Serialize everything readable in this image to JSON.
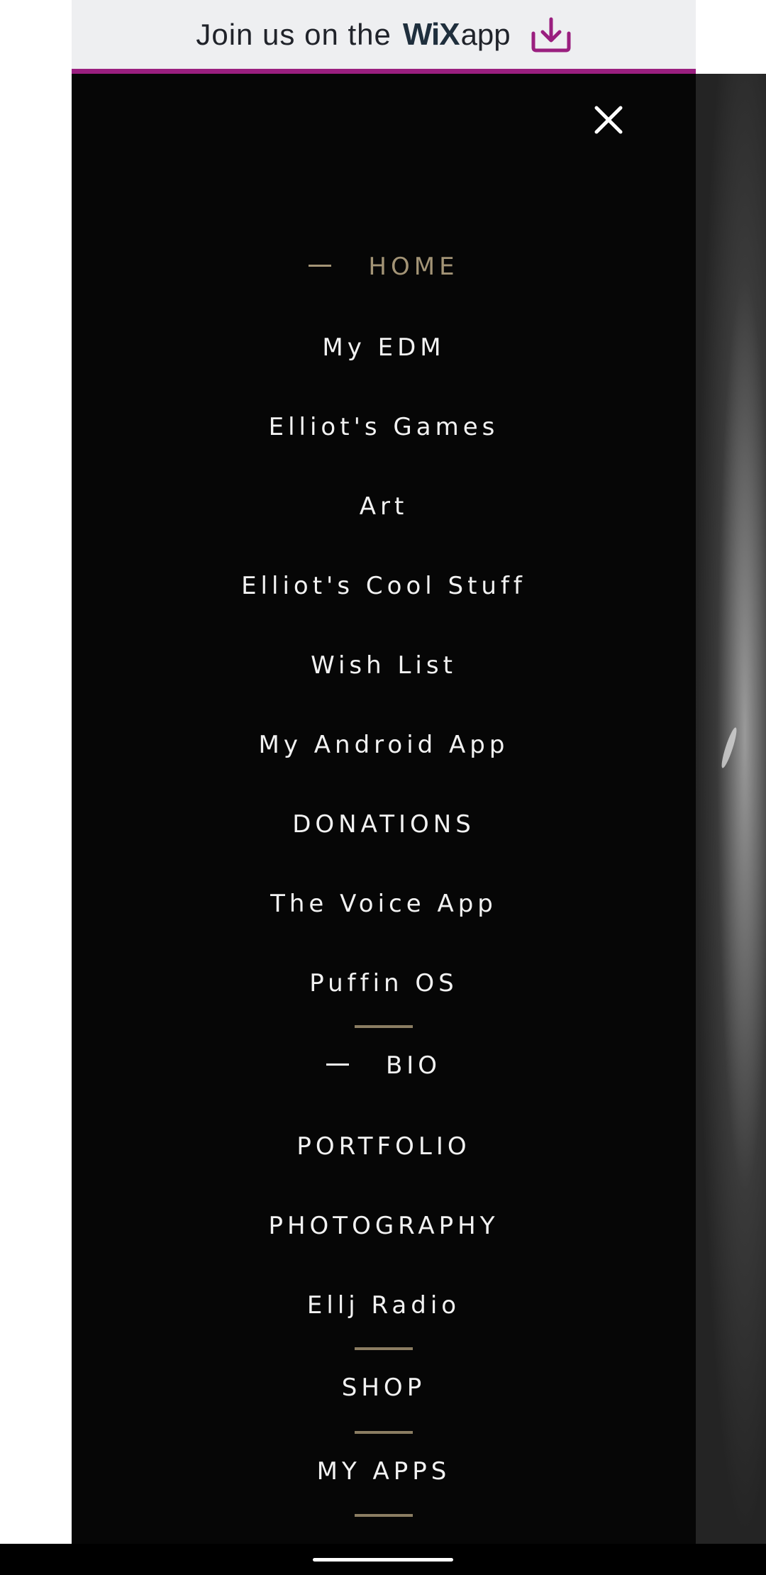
{
  "banner": {
    "text": "Join us on the",
    "logo_text": "WiX",
    "app_word": "app",
    "icon": "download-icon",
    "accent_color": "#9a1f7f",
    "background": "#eeeff1"
  },
  "menu": {
    "close_icon": "close-icon",
    "background": "#060606",
    "active_color": "#a39476",
    "items": [
      {
        "label": "HOME",
        "active": true
      },
      {
        "label": "My EDM"
      },
      {
        "label": "Elliot's Games"
      },
      {
        "label": "Art"
      },
      {
        "label": "Elliot's Cool Stuff"
      },
      {
        "label": "Wish List"
      },
      {
        "label": "My Android App"
      },
      {
        "label": "DONATIONS"
      },
      {
        "label": "The Voice App"
      },
      {
        "label": "Puffin OS"
      },
      {
        "label": "BIO"
      },
      {
        "label": "PORTFOLIO"
      },
      {
        "label": "PHOTOGRAPHY"
      },
      {
        "label": "Ellj Radio"
      },
      {
        "label": "SHOP"
      },
      {
        "label": "MY APPS"
      }
    ]
  }
}
